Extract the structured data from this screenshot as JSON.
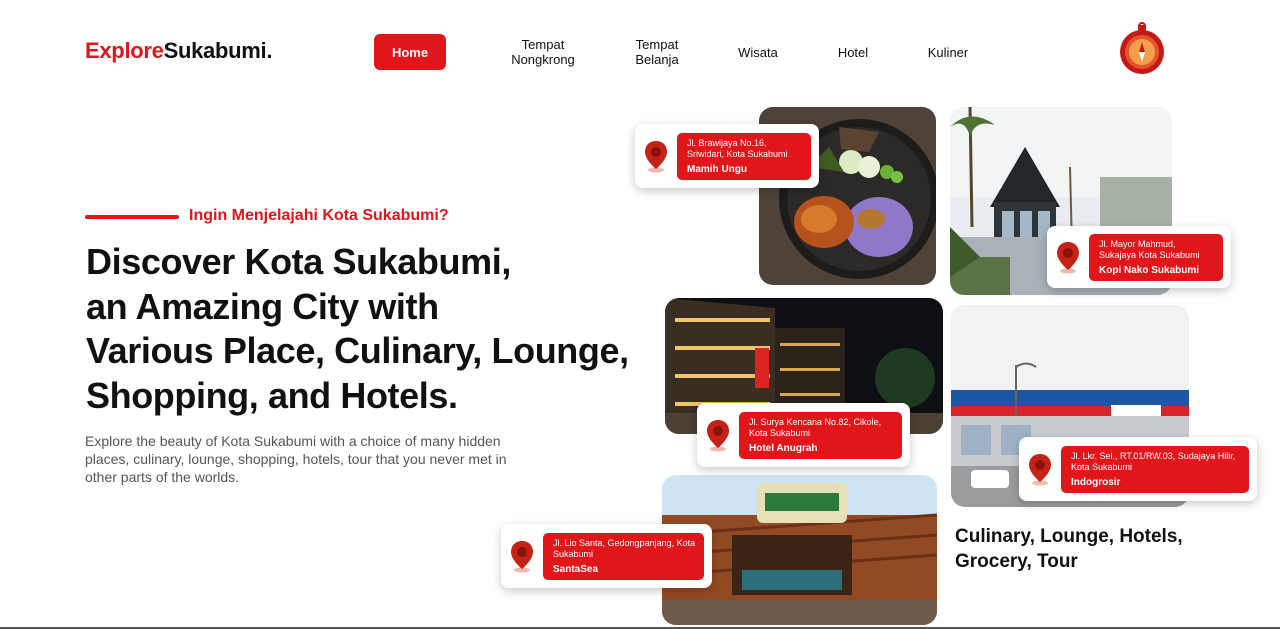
{
  "header": {
    "logo_part1": "Explore",
    "logo_part2": "Sukabumi.",
    "nav": [
      {
        "label": "Home",
        "active": true
      },
      {
        "label": "Tempat\nNongkrong",
        "active": false
      },
      {
        "label": "Tempat\nBelanja",
        "active": false
      },
      {
        "label": "Wisata",
        "active": false
      },
      {
        "label": "Hotel",
        "active": false
      },
      {
        "label": "Kuliner",
        "active": false
      }
    ],
    "compass_icon": "compass-icon"
  },
  "hero": {
    "kicker": "Ingin Menjelajahi Kota Sukabumi?",
    "headline_lines": [
      "Discover Kota Sukabumi,",
      "an Amazing City with",
      "Various Place, Culinary, Lounge,",
      "Shopping, and Hotels."
    ],
    "lead": "Explore the beauty of Kota Sukabumi with a choice of many hidden places, culinary, lounge, shopping, hotels, tour that you never met in other parts of the worlds."
  },
  "places": [
    {
      "address": "Jl. Brawijaya No.16, Sriwidari, Kota Sukabumi",
      "name": "Mamih Ungu"
    },
    {
      "address": "Jl. Mayor Mahmud, Sukajaya Kota Sukabumi",
      "name": "Kopi Nako Sukabumi"
    },
    {
      "address": "Jl. Surya Kencana No.82, Cikole, Kota Sukabumi",
      "name": "Hotel Anugrah"
    },
    {
      "address": "Jl. Lkr. Sel., RT.01/RW.03, Sudajaya Hilir, Kota Sukabumi",
      "name": "Indogrosir"
    },
    {
      "address": "Jl. Lio Santa, Gedongpanjang, Kota Sukabumi",
      "name": "SantaSea"
    }
  ],
  "side_caption": "Culinary, Lounge, Hotels, Grocery, Tour",
  "colors": {
    "accent": "#e0161b",
    "text": "#111111",
    "muted": "#555555"
  }
}
